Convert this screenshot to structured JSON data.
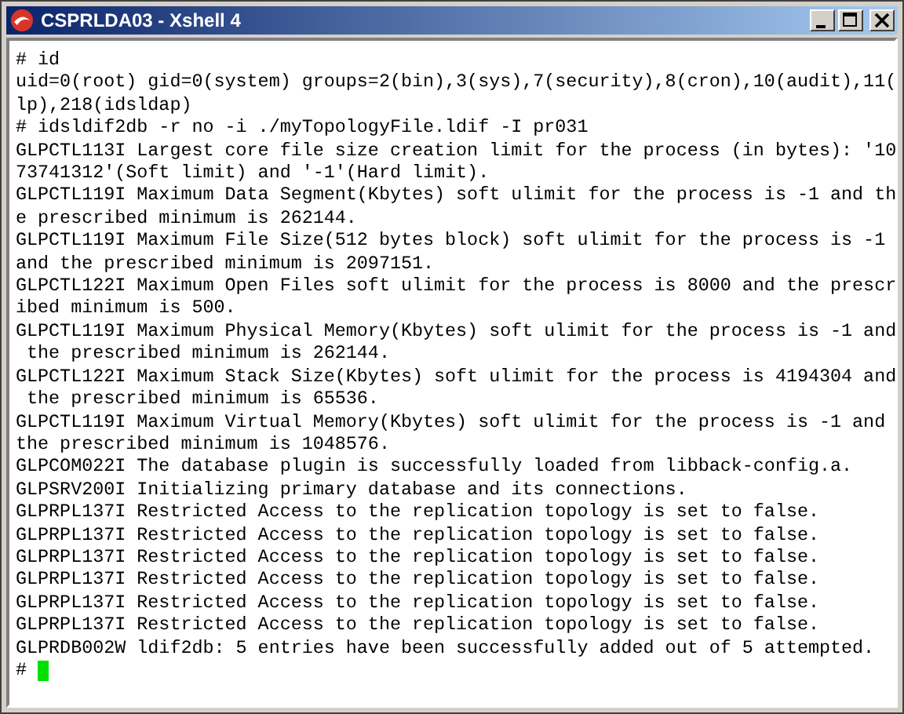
{
  "window": {
    "title": "CSPRLDA03 - Xshell 4"
  },
  "terminal": {
    "lines": [
      "# id",
      "uid=0(root) gid=0(system) groups=2(bin),3(sys),7(security),8(cron),10(audit),11(",
      "lp),218(idsldap)",
      "# idsldif2db -r no -i ./myTopologyFile.ldif -I pr031",
      "GLPCTL113I Largest core file size creation limit for the process (in bytes): '10",
      "73741312'(Soft limit) and '-1'(Hard limit).",
      "GLPCTL119I Maximum Data Segment(Kbytes) soft ulimit for the process is -1 and th",
      "e prescribed minimum is 262144.",
      "GLPCTL119I Maximum File Size(512 bytes block) soft ulimit for the process is -1",
      "and the prescribed minimum is 2097151.",
      "GLPCTL122I Maximum Open Files soft ulimit for the process is 8000 and the prescr",
      "ibed minimum is 500.",
      "GLPCTL119I Maximum Physical Memory(Kbytes) soft ulimit for the process is -1 and",
      " the prescribed minimum is 262144.",
      "GLPCTL122I Maximum Stack Size(Kbytes) soft ulimit for the process is 4194304 and",
      " the prescribed minimum is 65536.",
      "GLPCTL119I Maximum Virtual Memory(Kbytes) soft ulimit for the process is -1 and",
      "the prescribed minimum is 1048576.",
      "GLPCOM022I The database plugin is successfully loaded from libback-config.a.",
      "GLPSRV200I Initializing primary database and its connections.",
      "GLPRPL137I Restricted Access to the replication topology is set to false.",
      "GLPRPL137I Restricted Access to the replication topology is set to false.",
      "GLPRPL137I Restricted Access to the replication topology is set to false.",
      "GLPRPL137I Restricted Access to the replication topology is set to false.",
      "GLPRPL137I Restricted Access to the replication topology is set to false.",
      "GLPRPL137I Restricted Access to the replication topology is set to false.",
      "GLPRDB002W ldif2db: 5 entries have been successfully added out of 5 attempted."
    ],
    "prompt": "#",
    "cursor": {
      "visible": true
    }
  }
}
